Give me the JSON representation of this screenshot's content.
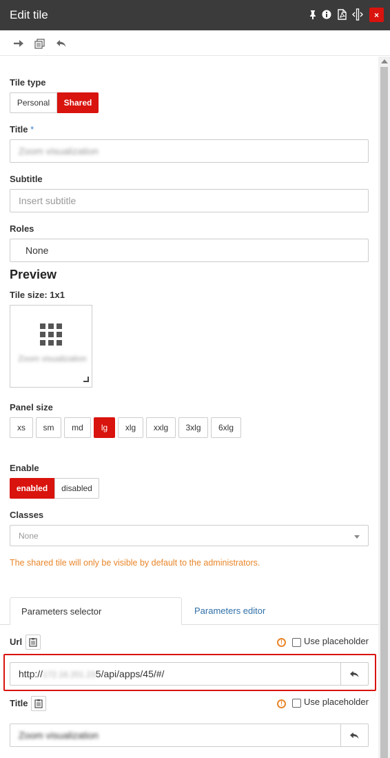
{
  "window": {
    "title": "Edit tile",
    "close_label": "×"
  },
  "titlebar_icons": [
    "pin-icon",
    "info-icon",
    "pdf-icon",
    "resize-icon"
  ],
  "toolbar_icons": [
    "arrow-right-icon",
    "copy-icon",
    "undo-icon"
  ],
  "tile_type": {
    "label": "Tile type",
    "options": [
      "Personal",
      "Shared"
    ],
    "selected": "Shared"
  },
  "title_field": {
    "label": "Title",
    "required_mark": "*",
    "value": "Zoom visualization"
  },
  "subtitle_field": {
    "label": "Subtitle",
    "placeholder": "Insert subtitle"
  },
  "roles_field": {
    "label": "Roles",
    "value": "None"
  },
  "preview": {
    "heading": "Preview",
    "tile_size": "Tile size: 1x1",
    "tile_name": "Zoom visualization"
  },
  "panel_size": {
    "label": "Panel size",
    "options": [
      "xs",
      "sm",
      "md",
      "lg",
      "xlg",
      "xxlg",
      "3xlg",
      "6xlg"
    ],
    "selected": "lg"
  },
  "enable": {
    "label": "Enable",
    "options": [
      "enabled",
      "disabled"
    ],
    "selected": "enabled"
  },
  "classes": {
    "label": "Classes",
    "value": "None"
  },
  "warning": "The shared tile will only be visible by default to the administrators.",
  "tabs": {
    "active": "Parameters selector",
    "inactive": "Parameters editor"
  },
  "params": {
    "url": {
      "label": "Url",
      "placeholder_label": "Use placeholder",
      "value_prefix": "http://",
      "value_hidden": "172.16.201.23",
      "value_suffix": "5/api/apps/45/#/"
    },
    "title": {
      "label": "Title",
      "placeholder_label": "Use placeholder",
      "value": "Zoom visualization"
    }
  }
}
